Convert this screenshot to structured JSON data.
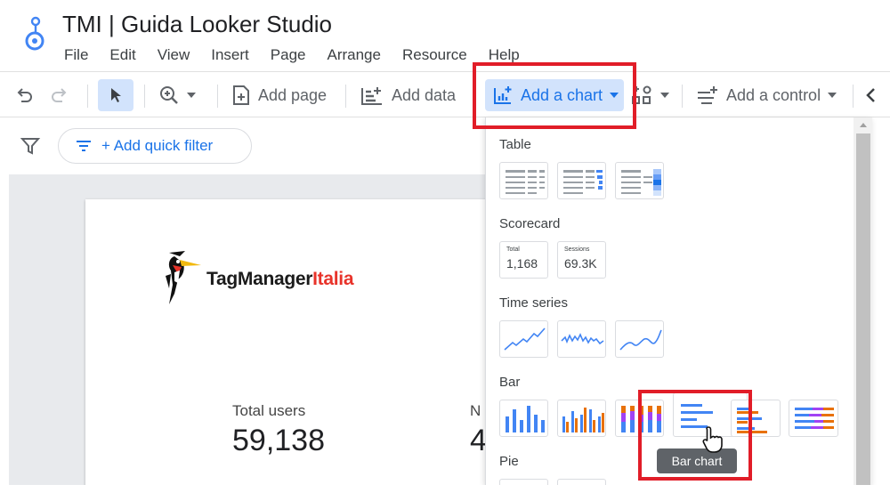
{
  "app": {
    "title": "TMI | Guida Looker Studio"
  },
  "menu": [
    "File",
    "Edit",
    "View",
    "Insert",
    "Page",
    "Arrange",
    "Resource",
    "Help"
  ],
  "toolbar": {
    "add_page": "Add page",
    "add_data": "Add data",
    "add_chart": "Add a chart",
    "add_control": "Add a control"
  },
  "filter": {
    "quick_filter": "+ Add quick filter"
  },
  "report": {
    "logo_part1": "TagManager",
    "logo_part2": "Italia",
    "metric1_label": "Total users",
    "metric1_value": "59,138",
    "metric2_label": "N",
    "metric2_value": "4"
  },
  "chart_menu": {
    "sections": {
      "table": "Table",
      "scorecard": "Scorecard",
      "time_series": "Time series",
      "bar": "Bar",
      "pie": "Pie"
    },
    "scorecard_tiles": [
      {
        "label": "Total",
        "value": "1,168"
      },
      {
        "label": "Sessions",
        "value": "69.3K"
      }
    ],
    "tooltip": "Bar chart"
  },
  "colors": {
    "accent": "#1a73e8",
    "highlight_red": "#e11d28",
    "orange": "#e8710a",
    "logo_red": "#e8332a"
  }
}
